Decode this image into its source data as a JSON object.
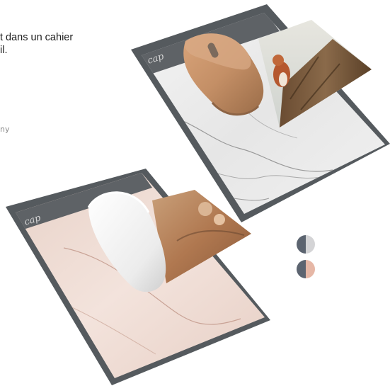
{
  "description_lines": [
    "t dans un cahier",
    "il."
  ],
  "side_note": "ny",
  "products": [
    {
      "name": "marble-grey",
      "logo": "cap",
      "mouse_color": "#c48f66"
    },
    {
      "name": "marble-pink",
      "logo": "cap",
      "mouse_color": "#eeeeee"
    }
  ],
  "swatches": [
    {
      "name": "grey-white",
      "left_color": "#5c6470",
      "right_color": "#d4d4d6"
    },
    {
      "name": "grey-pink",
      "left_color": "#5c6470",
      "right_color": "#e6b7a6"
    }
  ]
}
